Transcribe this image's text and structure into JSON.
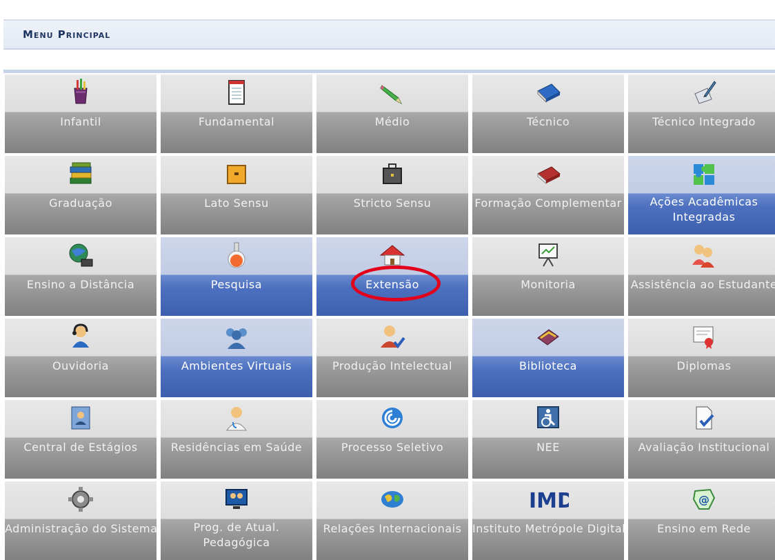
{
  "header": {
    "title": "Menu Principal"
  },
  "tiles": [
    {
      "label": "Infantil",
      "icon": "pencil-cup-icon",
      "active": false
    },
    {
      "label": "Fundamental",
      "icon": "notepad-icon",
      "active": false
    },
    {
      "label": "Médio",
      "icon": "green-pencil-icon",
      "active": false
    },
    {
      "label": "Técnico",
      "icon": "blue-book-icon",
      "active": false
    },
    {
      "label": "Técnico Integrado",
      "icon": "writing-quill-icon",
      "active": false
    },
    {
      "label": "Graduação",
      "icon": "book-stack-icon",
      "active": false
    },
    {
      "label": "Lato Sensu",
      "icon": "yellow-case-icon",
      "active": false
    },
    {
      "label": "Stricto Sensu",
      "icon": "briefcase-icon",
      "active": false
    },
    {
      "label": "Formação Complementar",
      "icon": "red-book-icon",
      "active": false
    },
    {
      "label": "Ações Acadêmicas Integradas",
      "icon": "puzzle-icon",
      "active": true
    },
    {
      "label": "Ensino a Distância",
      "icon": "globe-computer-icon",
      "active": false
    },
    {
      "label": "Pesquisa",
      "icon": "flask-icon",
      "active": true
    },
    {
      "label": "Extensão",
      "icon": "house-icon",
      "active": true
    },
    {
      "label": "Monitoria",
      "icon": "presentation-board-icon",
      "active": false
    },
    {
      "label": "Assistência ao Estudante",
      "icon": "people-icon",
      "active": false
    },
    {
      "label": "Ouvidoria",
      "icon": "headset-user-icon",
      "active": false
    },
    {
      "label": "Ambientes Virtuais",
      "icon": "group-icon",
      "active": true
    },
    {
      "label": "Produção Intelectual",
      "icon": "user-check-icon",
      "active": false
    },
    {
      "label": "Biblioteca",
      "icon": "books-icon",
      "active": true
    },
    {
      "label": "Diplomas",
      "icon": "certificate-icon",
      "active": false
    },
    {
      "label": "Central de Estágios",
      "icon": "contacts-icon",
      "active": false
    },
    {
      "label": "Residências em Saúde",
      "icon": "doctor-icon",
      "active": false
    },
    {
      "label": "Processo Seletivo",
      "icon": "swirl-icon",
      "active": false
    },
    {
      "label": "NEE",
      "icon": "accessibility-icon",
      "active": false
    },
    {
      "label": "Avaliação Institucional",
      "icon": "document-check-icon",
      "active": false
    },
    {
      "label": "Administração do Sistema",
      "icon": "gear-icon",
      "active": false
    },
    {
      "label": "Prog. de Atual. Pedagógica",
      "icon": "monitor-people-icon",
      "active": false
    },
    {
      "label": "Relações Internacionais",
      "icon": "world-map-icon",
      "active": false
    },
    {
      "label": "Instituto Metrópole Digital",
      "icon": "imd-logo-icon",
      "active": false,
      "logo_text": "IMD"
    },
    {
      "label": "Ensino em Rede",
      "icon": "brazil-at-icon",
      "active": false
    }
  ]
}
